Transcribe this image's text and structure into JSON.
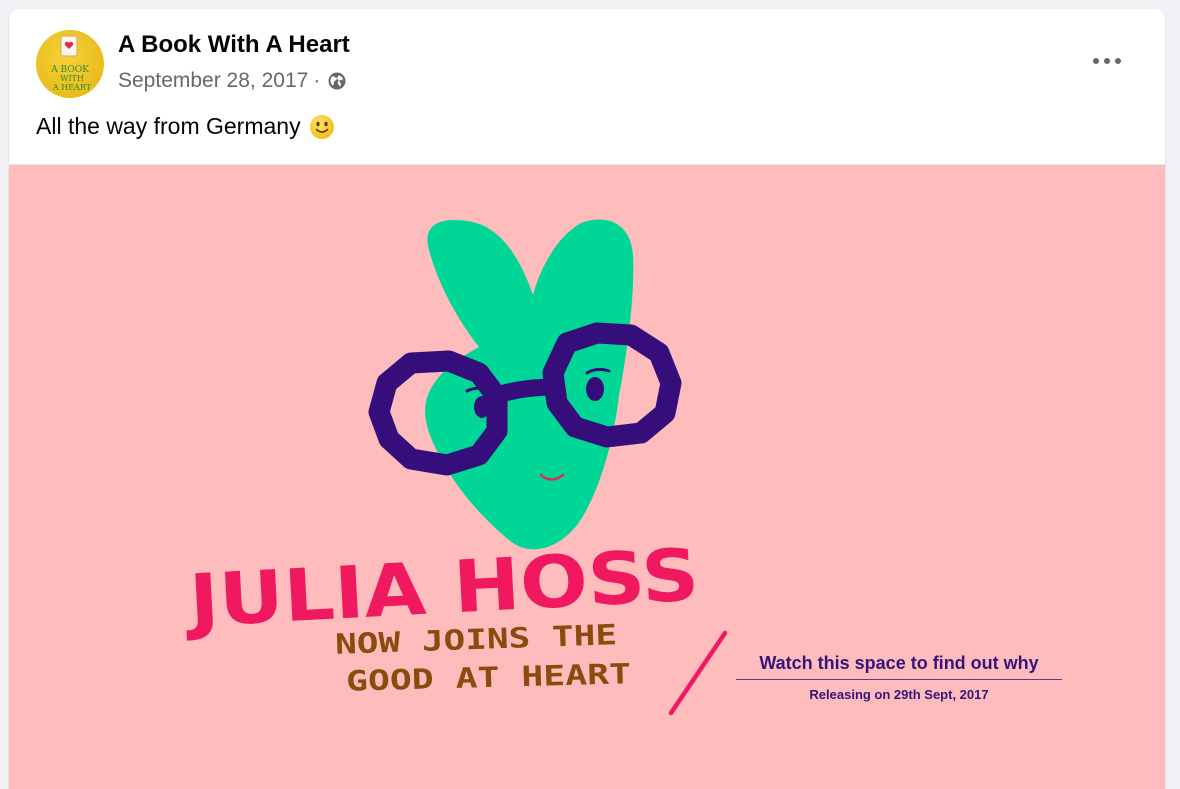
{
  "post": {
    "author": "A Book With A Heart",
    "date": "September 28, 2017",
    "separator": "·",
    "privacy_icon": "globe-icon",
    "more_icon": "more-options-icon",
    "text": "All the way from Germany",
    "emoji": "slightly-smiling-face-emoji"
  },
  "avatar": {
    "logo_line1": "A BOOK",
    "logo_line2": "WITH",
    "logo_line3": "A HEART"
  },
  "image": {
    "headline": "JULIA HOSS",
    "subline1": "NOW JOINS THE",
    "subline2": "GOOD AT HEART",
    "watch_text": "Watch this space to find out why",
    "release_text": "Releasing on 29th Sept, 2017",
    "colors": {
      "background": "#febcbd",
      "heart": "#00d696",
      "glasses": "#350e7b",
      "headline": "#f0185f",
      "subline": "#8c4a0c"
    }
  }
}
